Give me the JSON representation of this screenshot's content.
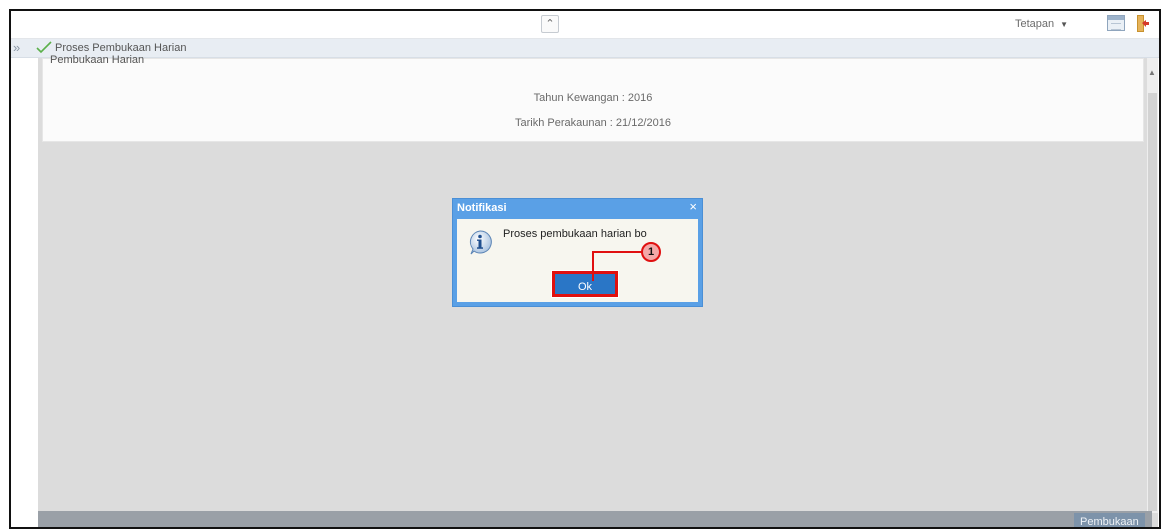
{
  "header": {
    "settings_label": "Tetapan",
    "collapse_icon": "double-chevron-up-icon",
    "calendar_icon": "calendar-icon",
    "logout_icon": "logout-icon"
  },
  "breadcrumb": {
    "title": "Proses Pembukaan Harian"
  },
  "panel": {
    "heading": "Pembukaan Harian",
    "financial_year": "Tahun Kewangan : 2016",
    "posting_date": "Tarikh Perakaunan : 21/12/2016"
  },
  "dialog": {
    "title": "Notifikasi",
    "close": "×",
    "message": "Proses pembukaan harian bo",
    "ok_label": "Ok"
  },
  "callout": {
    "number": "1"
  },
  "footer": {
    "button_label": "Pembukaan"
  },
  "colors": {
    "dialog_header": "#5aa0e6",
    "ok_button": "#2a76c6",
    "highlight": "#e01010",
    "footer_bar": "#9aa0a7"
  }
}
